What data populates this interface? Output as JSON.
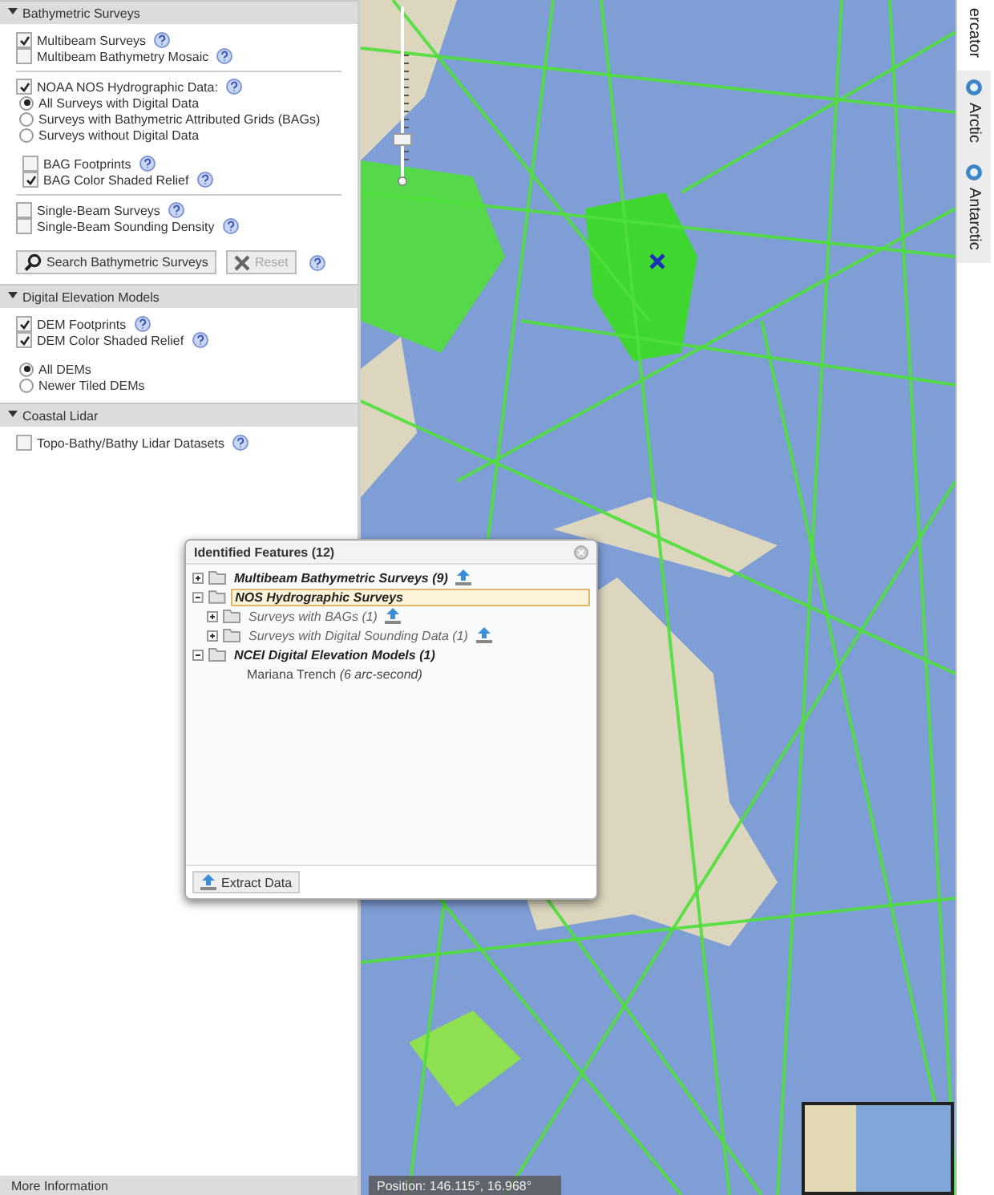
{
  "sidebar": {
    "sections": [
      {
        "title": "Bathymetric Surveys",
        "expanded": true,
        "items": [
          {
            "kind": "checkbox",
            "label": "Multibeam Surveys",
            "checked": true,
            "help": true
          },
          {
            "kind": "checkbox",
            "label": "Multibeam Bathymetry Mosaic",
            "checked": false,
            "help": true
          },
          {
            "kind": "divider"
          },
          {
            "kind": "checkbox",
            "label": "NOAA NOS Hydrographic Data:",
            "checked": true,
            "help": true
          },
          {
            "kind": "radio",
            "label": "All Surveys with Digital Data",
            "selected": true
          },
          {
            "kind": "radio",
            "label": "Surveys with Bathymetric Attributed Grids (BAGs)",
            "selected": false
          },
          {
            "kind": "radio",
            "label": "Surveys without Digital Data",
            "selected": false
          },
          {
            "kind": "spacer"
          },
          {
            "kind": "checkbox",
            "label": "BAG Footprints",
            "checked": false,
            "help": true,
            "indent": true
          },
          {
            "kind": "checkbox",
            "label": "BAG Color Shaded Relief",
            "checked": true,
            "help": true,
            "indent": true
          },
          {
            "kind": "divider"
          },
          {
            "kind": "checkbox",
            "label": "Single-Beam Surveys",
            "checked": false,
            "help": true
          },
          {
            "kind": "checkbox",
            "label": "Single-Beam Sounding Density",
            "checked": false,
            "help": true
          },
          {
            "kind": "buttons",
            "buttons": [
              {
                "label": "Search Bathymetric Surveys",
                "disabled": false
              },
              {
                "label": "Reset",
                "disabled": true
              }
            ],
            "help": true
          }
        ]
      },
      {
        "title": "Digital Elevation Models",
        "expanded": true,
        "items": [
          {
            "kind": "checkbox",
            "label": "DEM Footprints",
            "checked": true,
            "help": true
          },
          {
            "kind": "checkbox",
            "label": "DEM Color Shaded Relief",
            "checked": true,
            "help": true
          },
          {
            "kind": "spacer"
          },
          {
            "kind": "radio",
            "label": "All DEMs",
            "selected": true
          },
          {
            "kind": "radio",
            "label": "Newer Tiled DEMs",
            "selected": false
          }
        ]
      },
      {
        "title": "Coastal Lidar",
        "expanded": true,
        "items": [
          {
            "kind": "checkbox",
            "label": "Topo-Bathy/Bathy Lidar Datasets",
            "checked": false,
            "help": true
          }
        ]
      }
    ],
    "footer": "More Information"
  },
  "map": {
    "zoom": {
      "level": 0.2
    },
    "position": "Position: 146.115°, 16.968°"
  },
  "projection_tabs": [
    {
      "label": "ercator",
      "selected": true,
      "icon": false
    },
    {
      "label": "Arctic",
      "selected": false,
      "icon": true
    },
    {
      "label": "Antarctic",
      "selected": false,
      "icon": true
    }
  ],
  "popup": {
    "title": "Identified Features (12)",
    "tree": [
      {
        "label": "Multibeam Bathymetric Surveys (9)",
        "expanded": false,
        "selected": false,
        "download": true
      },
      {
        "label": "NOS Hydrographic Surveys",
        "expanded": true,
        "selected": true,
        "download": false,
        "children": [
          {
            "label": "Surveys with BAGs (1)",
            "expanded": false,
            "selected": false,
            "download": true
          },
          {
            "label": "Surveys with Digital Sounding Data (1)",
            "expanded": false,
            "selected": false,
            "download": true
          }
        ]
      },
      {
        "label": "NCEI Digital Elevation Models (1)",
        "expanded": true,
        "selected": false,
        "download": false,
        "children": [
          {
            "label": "Mariana Trench *(6 arc-second)*",
            "leaf": true,
            "selected": false
          }
        ]
      }
    ],
    "button": "Extract Data"
  }
}
